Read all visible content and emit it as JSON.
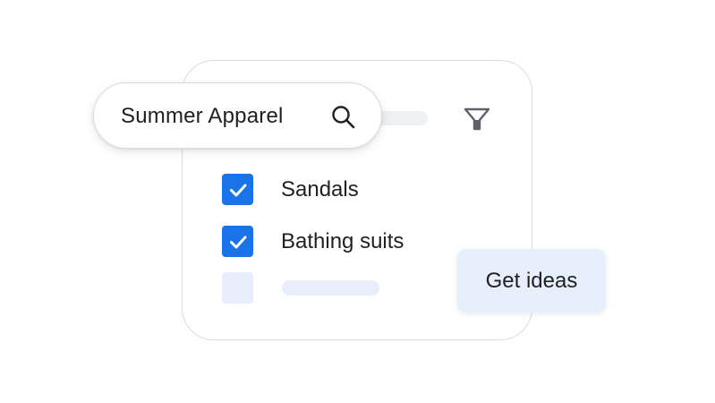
{
  "search": {
    "query": "Summer Apparel",
    "icon": "search-icon"
  },
  "filter": {
    "icon": "filter-icon"
  },
  "options": [
    {
      "label": "Sandals",
      "checked": true
    },
    {
      "label": "Bathing suits",
      "checked": true
    },
    {
      "label": "",
      "checked": false
    }
  ],
  "actions": {
    "get_ideas_label": "Get ideas"
  },
  "colors": {
    "accent": "#1a73e8",
    "border": "#dadce0",
    "placeholder": "#e8eefb",
    "button_bg": "#e8effc",
    "text": "#202124",
    "icon": "#5f6368"
  }
}
